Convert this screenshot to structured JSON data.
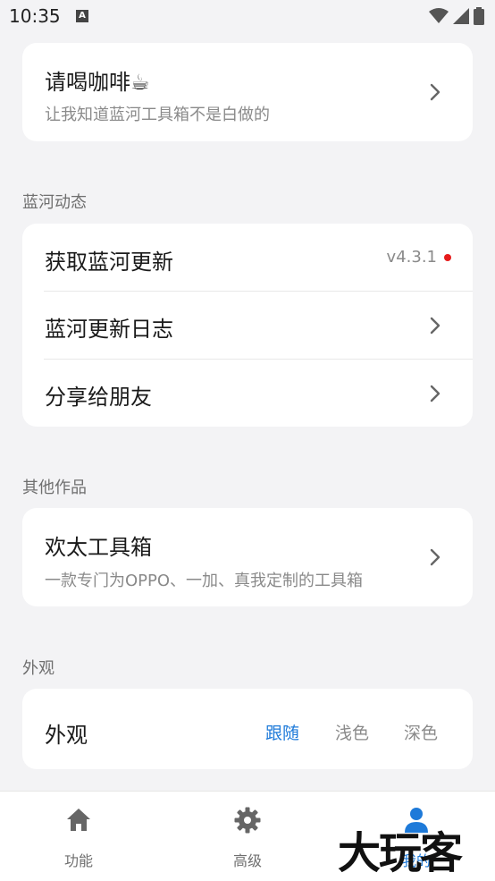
{
  "status_bar": {
    "time": "10:35",
    "notification_icon": "A"
  },
  "coffee_card": {
    "title": "请喝咖啡☕",
    "subtitle": "让我知道蓝河工具箱不是白做的"
  },
  "sections": {
    "updates_label": "蓝河动态",
    "others_label": "其他作品",
    "appearance_label": "外观"
  },
  "updates": {
    "get_update": "获取蓝河更新",
    "version": "v4.3.1",
    "changelog": "蓝河更新日志",
    "share": "分享给朋友"
  },
  "other_works": {
    "title": "欢太工具箱",
    "subtitle": "一款专门为OPPO、一加、真我定制的工具箱"
  },
  "appearance": {
    "title": "外观",
    "options": [
      "跟随",
      "浅色",
      "深色"
    ],
    "selected": "跟随"
  },
  "bottom_nav": {
    "items": [
      {
        "label": "功能",
        "icon": "home-icon"
      },
      {
        "label": "高级",
        "icon": "gear-icon"
      },
      {
        "label": "我的",
        "icon": "person-icon"
      }
    ],
    "active": "我的"
  },
  "watermark": "大玩客",
  "colors": {
    "accent": "#1e7ad9",
    "badge": "#e61b1b",
    "background": "#f3f3f5"
  }
}
